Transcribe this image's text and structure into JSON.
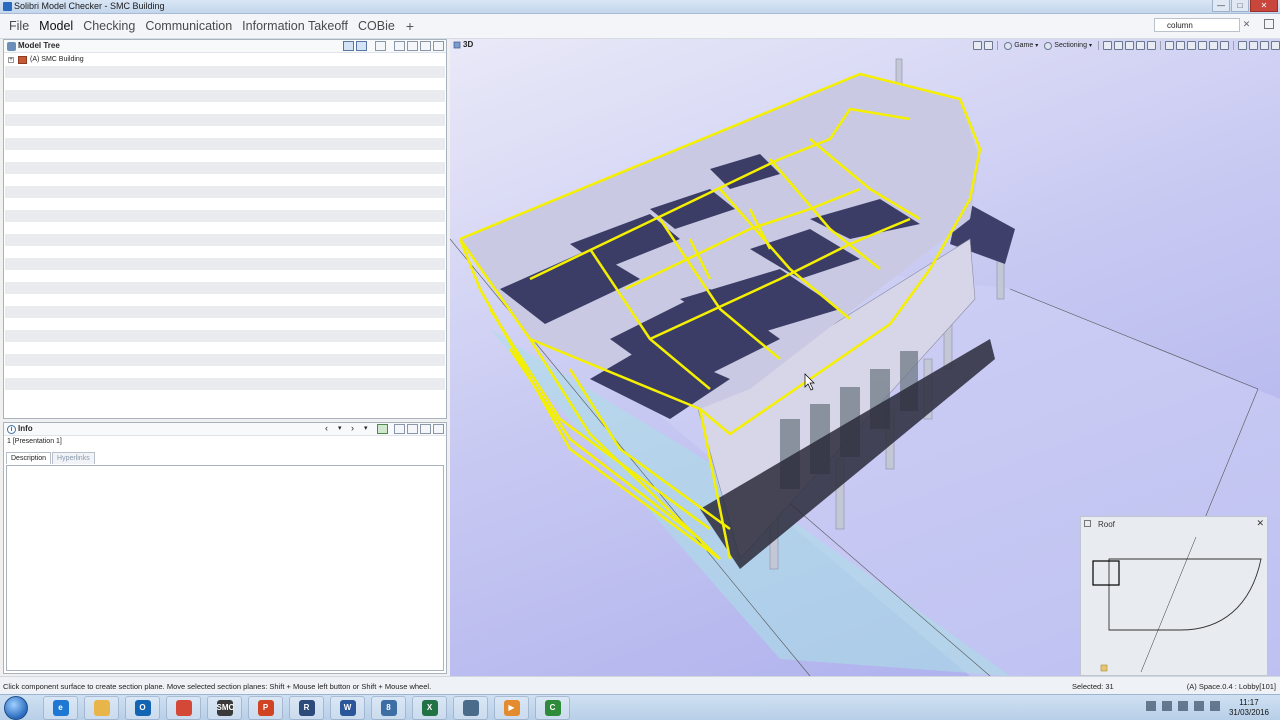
{
  "window": {
    "title": "Solibri Model Checker - SMC Building",
    "minimize": "—",
    "maximize": "□",
    "close": "✕"
  },
  "menu": {
    "items": [
      "File",
      "Model",
      "Checking",
      "Communication",
      "Information Takeoff",
      "COBie"
    ],
    "active_index": 1,
    "add": "+"
  },
  "search": {
    "value": "column",
    "clear": "✕"
  },
  "model_tree": {
    "title": "Model Tree",
    "root_expander": "+",
    "root_label": "(A) SMC Building"
  },
  "info": {
    "title": "Info",
    "subtitle": "1 [Presentation 1]",
    "tabs": [
      "Description",
      "Hyperlinks"
    ],
    "active_tab": 0
  },
  "viewport": {
    "title": "3D",
    "navigation_mode": "Game",
    "sectioning_label": "Sectioning",
    "highlight_color": "#f4f000",
    "background_color": "#b9bbf0"
  },
  "minimap": {
    "title": "Roof",
    "close": "✕"
  },
  "status": {
    "hint": "Click component surface to create section plane. Move selected section planes: Shift + Mouse left button or Shift + Mouse wheel.",
    "selected": "Selected: 31",
    "space": "(A) Space.0.4 : Lobby[101]"
  },
  "taskbar": {
    "apps": [
      {
        "name": "internet-explorer",
        "color": "#1e77d3",
        "glyph": "e"
      },
      {
        "name": "file-explorer",
        "color": "#e7b54a",
        "glyph": ""
      },
      {
        "name": "outlook",
        "color": "#1464b4",
        "glyph": "O"
      },
      {
        "name": "chrome",
        "color": "#d34836",
        "glyph": ""
      },
      {
        "name": "smc",
        "color": "#3a3a3a",
        "glyph": "SMC"
      },
      {
        "name": "powerpoint",
        "color": "#d04423",
        "glyph": "P"
      },
      {
        "name": "revit",
        "color": "#2c4a7a",
        "glyph": "R"
      },
      {
        "name": "word",
        "color": "#2b579a",
        "glyph": "W"
      },
      {
        "name": "app-8",
        "color": "#3d6fa5",
        "glyph": "8"
      },
      {
        "name": "excel",
        "color": "#217346",
        "glyph": "X"
      },
      {
        "name": "app-tools",
        "color": "#4b6b8a",
        "glyph": ""
      },
      {
        "name": "media-player",
        "color": "#e38b2e",
        "glyph": "▶"
      },
      {
        "name": "solibri-app",
        "color": "#2e8b3a",
        "glyph": "C"
      }
    ],
    "time": "11:17",
    "date": "31/03/2016"
  }
}
